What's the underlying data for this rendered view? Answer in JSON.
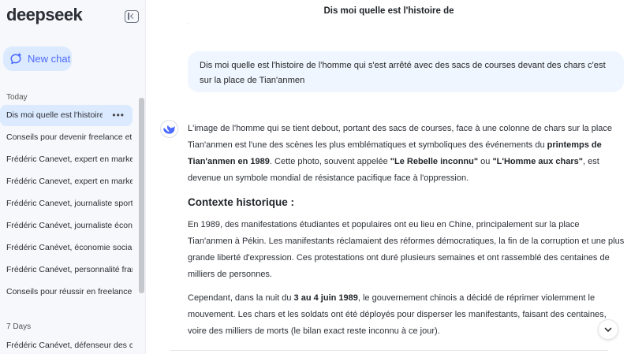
{
  "sidebar": {
    "logo": "deepseek",
    "new_chat_label": "New chat",
    "sections": [
      {
        "label": "Today",
        "items": [
          "Dis moi quelle est l'histoire de l'homme",
          "Conseils pour devenir freelance et",
          "Frédéric Canevet, expert en marketing",
          "Frédéric Canevet, expert en marketing",
          "Frédéric Canevet, journaliste sportif",
          "Frédéric Canévet, journaliste économique",
          "Frédéric Canévet, économie sociale",
          "Frédéric Canévet, personnalité française",
          "Conseils pour réussir en freelance"
        ]
      },
      {
        "label": "7 Days",
        "items": [
          "Frédéric Canévet, défenseur des causes"
        ]
      }
    ],
    "active_more": "•••"
  },
  "header": {
    "title": "Dis moi quelle est l'histoire de",
    "dot": "."
  },
  "conversation": {
    "user_message": "Dis moi quelle est l'histoire de l'homme qui s'est arrêté avec des sacs de courses devant des chars c'est sur la place de Tian'anmen",
    "answer": {
      "p1_a": "L'image de l'homme qui se tient debout, portant des sacs de courses, face à une colonne de chars sur la place Tian'anmen est l'une des scènes les plus emblématiques et symboliques des événements du ",
      "p1_b1": "printemps de Tian'anmen en 1989",
      "p1_c": ". Cette photo, souvent appelée ",
      "p1_b2": "\"Le Rebelle inconnu\"",
      "p1_d": " ou ",
      "p1_b3": "\"L'Homme aux chars\"",
      "p1_e": ", est devenue un symbole mondial de résistance pacifique face à l'oppression.",
      "heading": "Contexte historique :",
      "p2": "En 1989, des manifestations étudiantes et populaires ont eu lieu en Chine, principalement sur la place Tian'anmen à Pékin. Les manifestants réclamaient des réformes démocratiques, la fin de la corruption et une plus grande liberté d'expression. Ces protestations ont duré plusieurs semaines et ont rassemblé des centaines de milliers de personnes.",
      "p3_a": "Cependant, dans la nuit du ",
      "p3_b": "3 au 4 juin 1989",
      "p3_c": ", le gouvernement chinois a décidé de réprimer violemment le mouvement. Les chars et les soldats ont été déployés pour disperser les manifestants, faisant des centaines, voire des milliers de morts (le bilan exact reste inconnu à ce jour)."
    }
  },
  "colors": {
    "accent": "#4d6bfe",
    "active_bg": "#dbeafe",
    "bubble_bg": "#eff6ff",
    "sidebar_bg": "#f6f8fb"
  },
  "icons": {
    "collapse": "sidebar-collapse-icon",
    "new_chat": "chat-plus-icon",
    "assistant": "deepseek-whale-icon",
    "scroll": "chevron-down-icon"
  }
}
